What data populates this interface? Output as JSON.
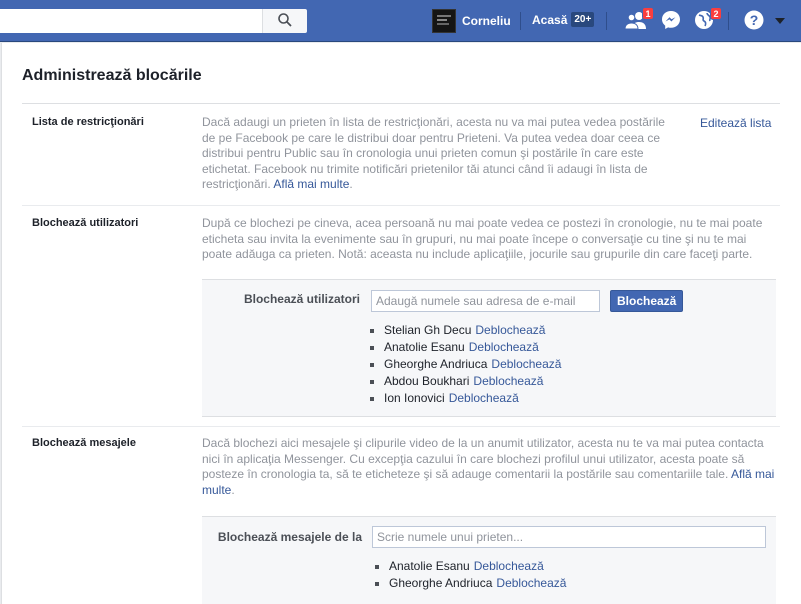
{
  "topbar": {
    "search_placeholder": "",
    "profile_name": "Corneliu",
    "home_label": "Acasă",
    "home_count": "20+",
    "friend_requests_badge": "1",
    "notifications_badge": "2"
  },
  "page": {
    "title": "Administrează blocările"
  },
  "restrict": {
    "label": "Lista de restricţionări",
    "desc": "Dacă adaugi un prieten în lista de restricţionări, acesta nu va mai putea vedea postările de pe Facebook pe care le distribui doar pentru Prieteni. Va putea vedea doar ceea ce distribui pentru Public sau în cronologia unui prieten comun şi postările în care este etichetat. Facebook nu trimite notificări prietenilor tăi atunci când îi adaugi în lista de restricţionări.",
    "learn_more": "Află mai multe",
    "edit_link": "Editează lista"
  },
  "block_users": {
    "label": "Blochează utilizatori",
    "desc": "După ce blochezi pe cineva, acea persoană nu mai poate vedea ce postezi în cronologie, nu te mai poate eticheta sau invita la evenimente sau în grupuri, nu mai poate începe o conversaţie cu tine şi nu te mai poate adăuga ca prieten. Notă: aceasta nu include aplicaţiile, jocurile sau grupurile din care faceţi parte.",
    "form_label": "Blochează utilizatori",
    "input_placeholder": "Adaugă numele sau adresa de e-mail",
    "button_label": "Blochează",
    "unblock_label": "Deblochează",
    "users": [
      "Stelian Gh Decu",
      "Anatolie Esanu",
      "Gheorghe Andriuca",
      "Abdou Boukhari",
      "Ion Ionovici"
    ]
  },
  "block_messages": {
    "label": "Blochează mesajele",
    "desc": "Dacă blochezi aici mesajele şi clipurile video de la un anumit utilizator, acesta nu te va mai putea contacta nici în aplicaţia Messenger. Cu excepţia cazului în care blochezi profilul unui utilizator, acesta poate să posteze în cronologia ta, să te eticheteze şi să adauge comentarii la postările sau comentariile tale.",
    "learn_more": "Află mai multe",
    "form_label": "Blochează mesajele de la",
    "input_placeholder": "Scrie numele unui prieten...",
    "unblock_label": "Deblochează",
    "users": [
      "Anatolie Esanu",
      "Gheorghe Andriuca"
    ]
  }
}
